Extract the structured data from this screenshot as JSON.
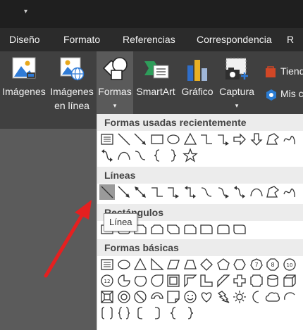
{
  "tabs": [
    "Diseño",
    "Formato",
    "Referencias",
    "Correspondencia",
    "R"
  ],
  "ribbon": {
    "imagenes": "Imágenes",
    "online_line1": "Imágenes",
    "online_line2": "en línea",
    "formas": "Formas",
    "smartart": "SmartArt",
    "grafico": "Gráfico",
    "captura": "Captura",
    "tienda": "Tiend",
    "mis": "Mis c"
  },
  "dropdown": {
    "recent_title": "Formas usadas recientemente",
    "lines_title": "Líneas",
    "rect_title": "Rectángulos",
    "basic_title": "Formas básicas"
  },
  "tooltip": "Línea",
  "colors": {
    "accent_red": "#e52020",
    "office_orange": "#d24726",
    "office_blue": "#2b7cd3"
  }
}
